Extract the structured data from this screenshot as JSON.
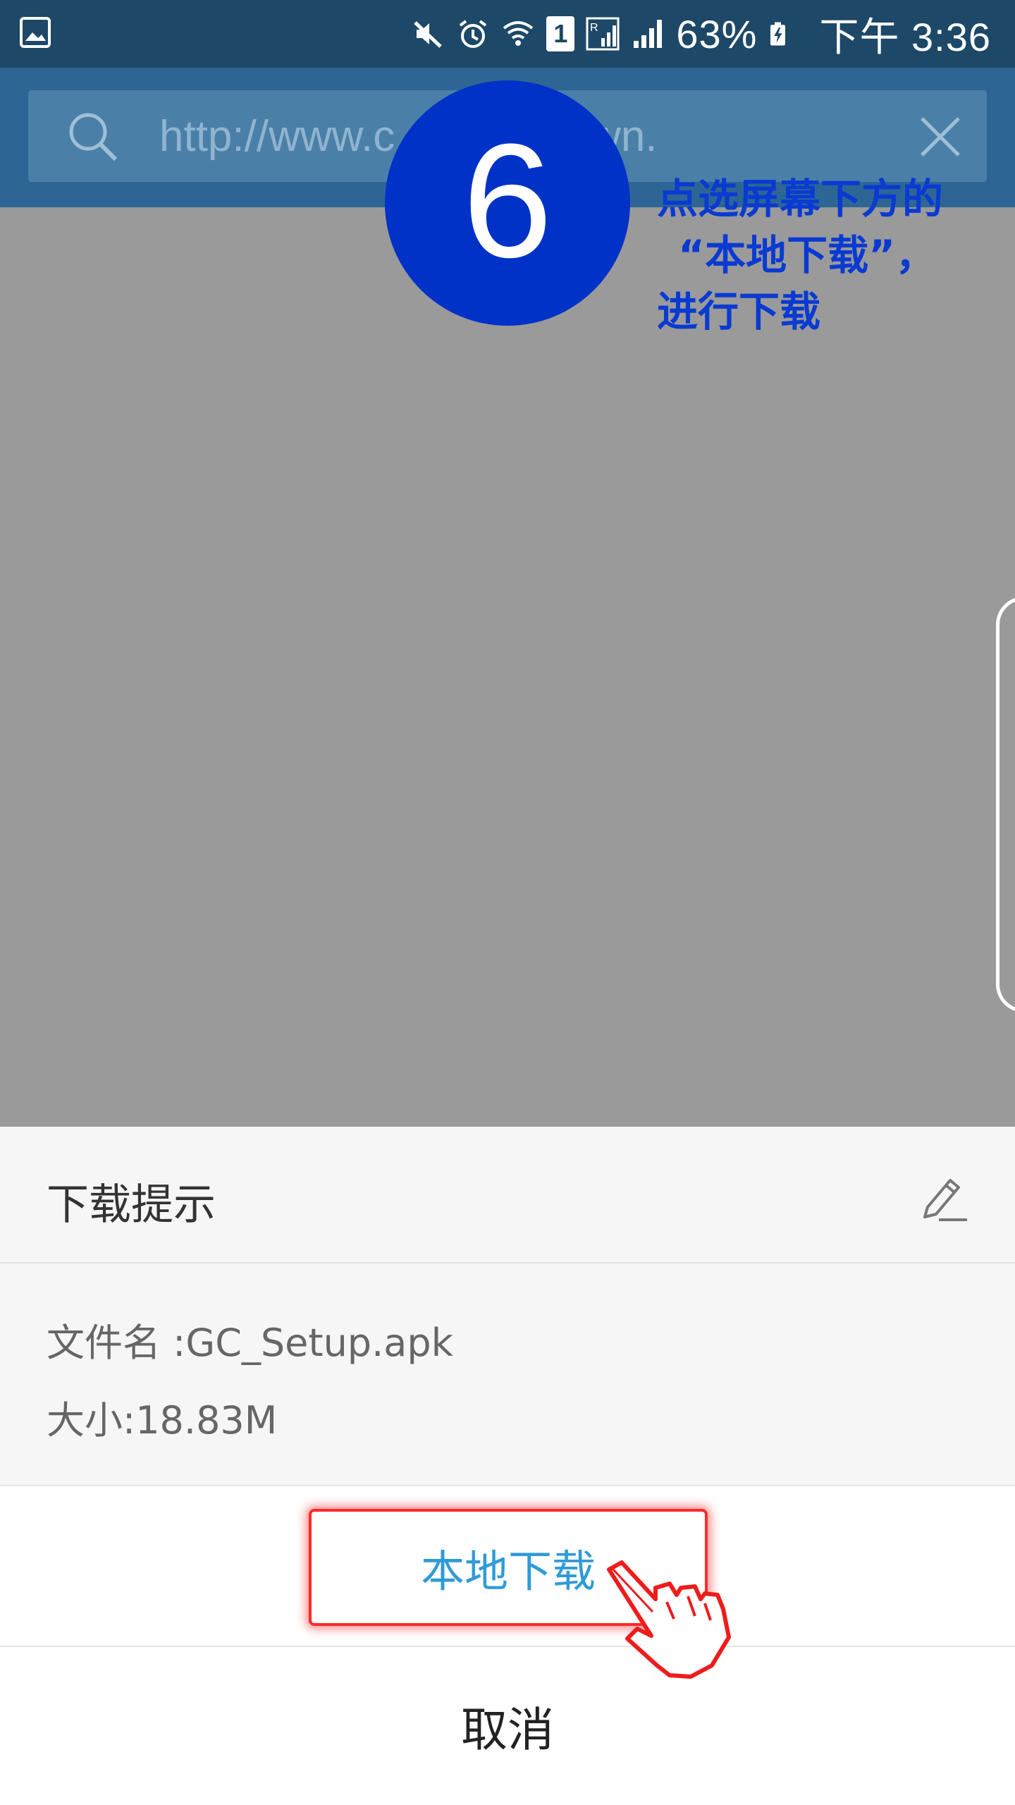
{
  "status_bar": {
    "battery_percent": "63%",
    "time": "下午 3:36",
    "sim_slot": "1",
    "icons": [
      "gallery-icon",
      "mute-icon",
      "alarm-icon",
      "wifi-icon",
      "sim-icon",
      "roaming-signal-icon",
      "signal-icon",
      "battery-charging-icon"
    ]
  },
  "search_bar": {
    "url": "http://www.c          n/app_down."
  },
  "annotation": {
    "step_number": "6",
    "line1": "点选屏幕下方的",
    "line2": "“本地下载”，",
    "line3": "进行下载"
  },
  "dialog": {
    "title": "下载提示",
    "filename": "文件名 :GC_Setup.apk",
    "size": "大小:18.83M",
    "local_download_label": "本地下载",
    "cancel_label": "取消"
  },
  "colors": {
    "status_bar": "#1e4867",
    "top_bar": "#2d6694",
    "step_circle": "#0032c8",
    "annotation_text": "#0a3ad2",
    "highlight": "#ff2a2a",
    "local_button_text": "#2f9bd6"
  }
}
